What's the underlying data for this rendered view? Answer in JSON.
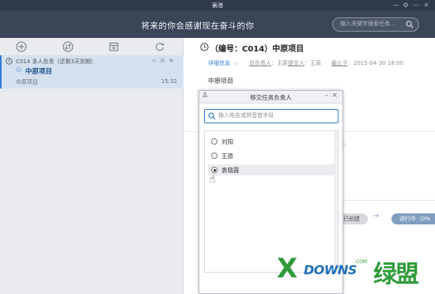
{
  "window": {
    "title": "襄港",
    "controls": [
      "—",
      "⚙",
      "—",
      "✕"
    ]
  },
  "header": {
    "slogan": "将来的你会感谢现在奋斗的你",
    "search_placeholder": "输入关键字搜索任务..."
  },
  "left_toolbar": {
    "icons": [
      "add-icon",
      "sort-icon",
      "calendar-icon",
      "refresh-icon"
    ]
  },
  "task_list": [
    {
      "meta": "C014 多人负责（还剩3天到期）",
      "name": "中原项目",
      "project": "中原项目",
      "time": "15:32"
    }
  ],
  "detail": {
    "title": "（编号：C014）中原项目",
    "detail_link": "详细信息",
    "owner_label": "总负责人",
    "owner": "：王原",
    "submitter_label": "提交人",
    "submitter": "：王原",
    "deadline_label": "截止于",
    "deadline": "：2015-04-30 18:00",
    "project": "中原项目",
    "status_created": "已创建",
    "status_progress": "进行中（0%"
  },
  "dialog": {
    "title": "移交任务负责人",
    "search_placeholder": "输入姓名或拼音首字母",
    "people": [
      {
        "name": "刘阳",
        "selected": false
      },
      {
        "name": "王原",
        "selected": false
      },
      {
        "name": "袁晓霞",
        "selected": true
      }
    ]
  },
  "watermark": {
    "brand": "DOWNS",
    "suffix": ".COM",
    "cn": "绿盟"
  }
}
